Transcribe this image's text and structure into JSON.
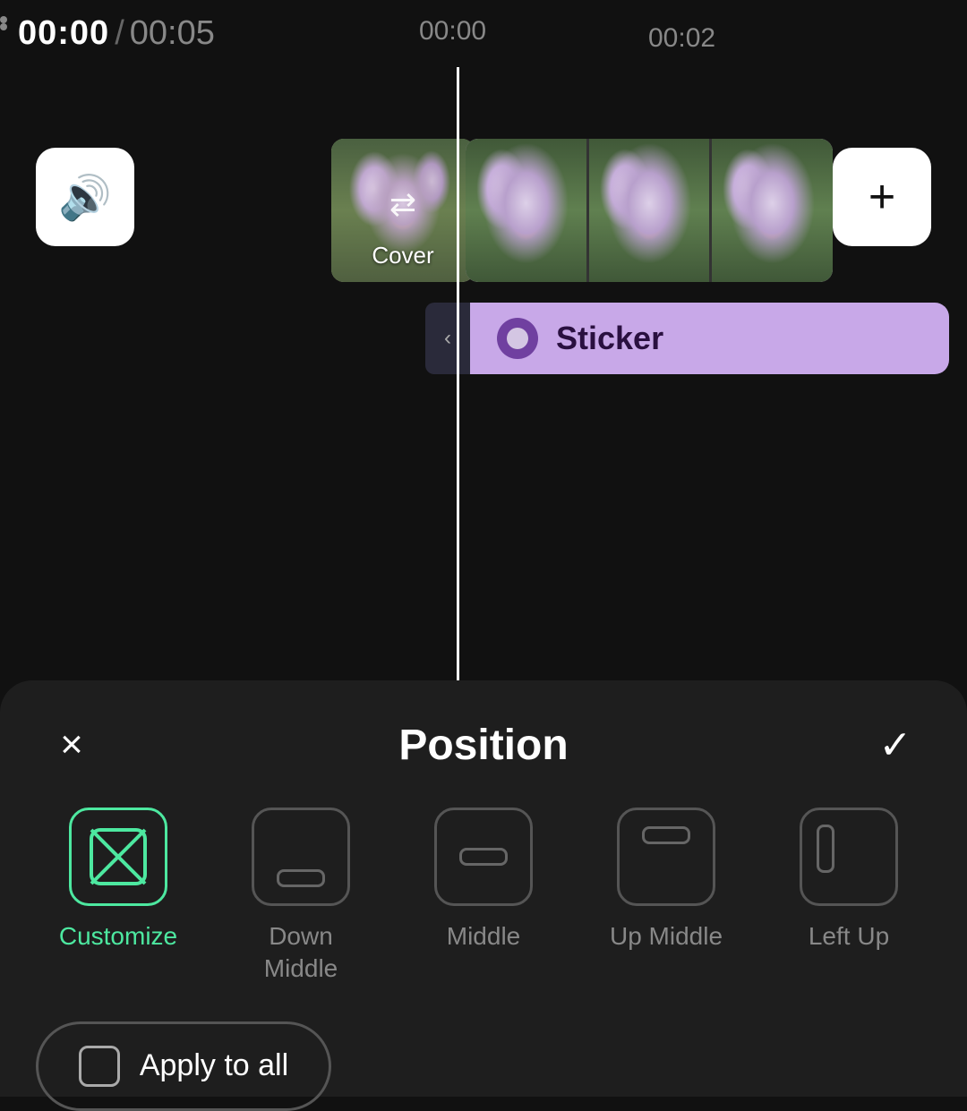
{
  "timeline": {
    "current_time": "00:00",
    "total_time": "00:05",
    "marker_0": "00:00",
    "marker_1": "00:02"
  },
  "cover": {
    "label": "Cover"
  },
  "sticker": {
    "label": "Sticker"
  },
  "panel": {
    "title": "Position",
    "close_label": "×",
    "confirm_label": "✓"
  },
  "positions": [
    {
      "id": "customize",
      "label": "Customize",
      "active": true
    },
    {
      "id": "down-middle",
      "label": "Down\nMiddle",
      "active": false
    },
    {
      "id": "middle",
      "label": "Middle",
      "active": false
    },
    {
      "id": "up-middle",
      "label": "Up Middle",
      "active": false
    },
    {
      "id": "left-up",
      "label": "Left Up",
      "active": false
    }
  ],
  "apply_all": {
    "label": "Apply to all"
  },
  "colors": {
    "active": "#4de8a0",
    "inactive": "#888888",
    "sticker_bg": "#c8a8e8",
    "sticker_dot": "#7040a0",
    "panel_bg": "#1e1e1e"
  }
}
